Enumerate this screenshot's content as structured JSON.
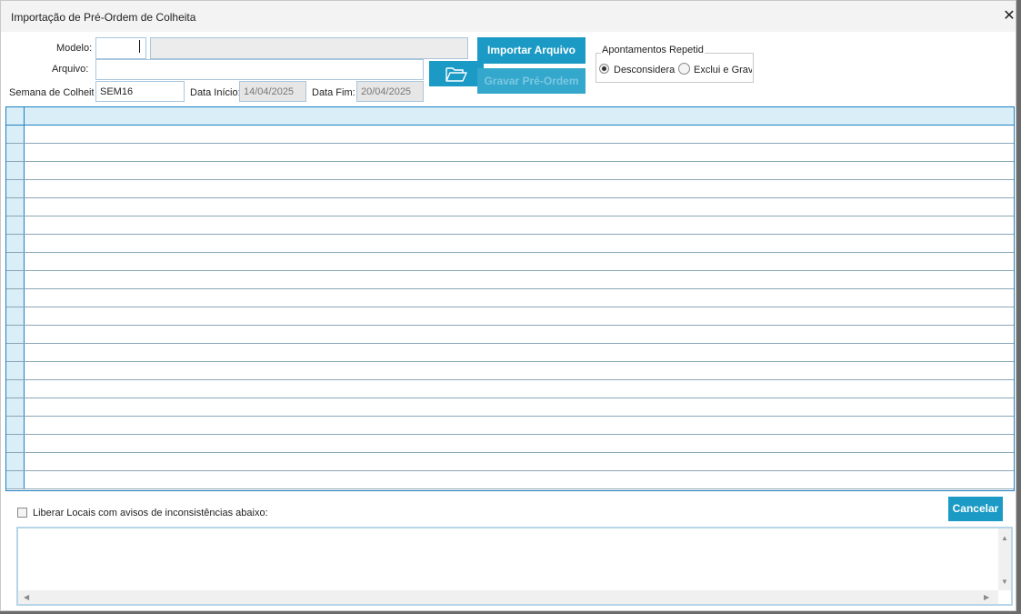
{
  "window": {
    "title": "Importação de Pré-Ordem de Colheita",
    "close_icon": "close-icon"
  },
  "form": {
    "modelo_label": "Modelo:",
    "modelo_code": "",
    "modelo_description": "",
    "arquivo_label": "Arquivo:",
    "arquivo_value": "",
    "semana_label": "Semana de Colheita",
    "semana_value": "SEM16",
    "data_inicio_label": "Data Início:",
    "data_inicio_value": "14/04/2025",
    "data_fim_label": "Data Fim:",
    "data_fim_value": "20/04/2025"
  },
  "buttons": {
    "importar": "Importar Arquivo",
    "gravar": "Gravar Pré-Ordem",
    "cancelar": "Cancelar",
    "folder_icon": "folder-open-icon"
  },
  "apontamentos": {
    "legend": "Apontamentos Repetid",
    "options": [
      {
        "label": "Desconsidera",
        "selected": true
      },
      {
        "label": "Exclui e Grav",
        "selected": false
      }
    ]
  },
  "grid": {
    "rows": []
  },
  "footer": {
    "liberar_label": "Liberar Locais com avisos de inconsistências abaixo:",
    "liberar_checked": false,
    "memo_text": ""
  }
}
